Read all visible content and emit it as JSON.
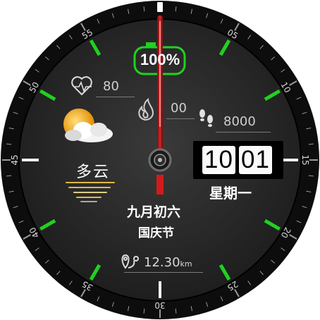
{
  "battery": {
    "percent_label": "100%",
    "level": 1.0
  },
  "heart_rate": {
    "value": "80",
    "icon": "heart-pulse-icon"
  },
  "calories": {
    "value": "00",
    "icon": "flame-icon"
  },
  "steps": {
    "value": "8000",
    "icon": "footprints-icon"
  },
  "weather": {
    "condition": "多云",
    "icon": "partly-cloudy-icon"
  },
  "time": {
    "hour": "10",
    "minute": "01"
  },
  "weekday": "星期一",
  "lunar_date": "九月初六",
  "holiday": "国庆节",
  "distance": {
    "value": "12.30",
    "unit": "km",
    "icon": "route-pin-icon"
  },
  "bezel": {
    "minute_labels": [
      "05",
      "10",
      "15",
      "20",
      "25",
      "30",
      "35",
      "40",
      "45",
      "50",
      "55"
    ]
  },
  "colors": {
    "accent": "#1fd21f",
    "hand": "#b01a1a",
    "background": "#262626",
    "bezel": "#111111"
  }
}
